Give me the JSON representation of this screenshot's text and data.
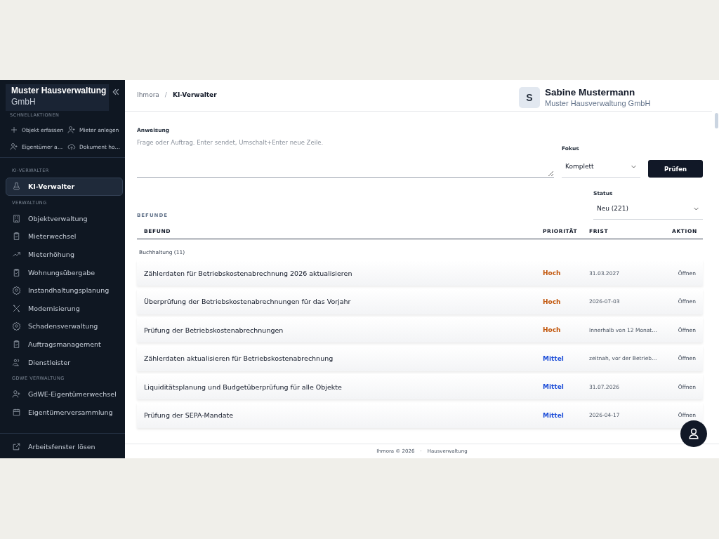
{
  "sidebar": {
    "org_name": "Muster Hausverwaltung",
    "org_suffix": "GmbH",
    "quick_actions_heading": "SCHNELLAKTIONEN",
    "quick_actions": [
      "Objekt erfassen",
      "Mieter anlegen",
      "Eigentümer a…",
      "Dokument ho…"
    ],
    "sections": [
      {
        "heading": "KI-VERWALTER",
        "items": [
          {
            "label": "KI-Verwalter",
            "selected": true
          }
        ]
      },
      {
        "heading": "VERWALTUNG",
        "items": [
          {
            "label": "Objektverwaltung",
            "selected": false
          },
          {
            "label": "Mieterwechsel",
            "selected": false
          },
          {
            "label": "Mieterhöhung",
            "selected": false
          },
          {
            "label": "Wohnungsübergabe",
            "selected": false
          },
          {
            "label": "Instandhaltungsplanung",
            "selected": false
          },
          {
            "label": "Modernisierung",
            "selected": false
          },
          {
            "label": "Schadensverwaltung",
            "selected": false
          },
          {
            "label": "Auftragsmanagement",
            "selected": false
          },
          {
            "label": "Dienstleister",
            "selected": false
          }
        ]
      },
      {
        "heading": "GDWE VERWALTUNG",
        "items": [
          {
            "label": "GdWE-Eigentümerwechsel",
            "selected": false
          },
          {
            "label": "Eigentümerversammlung",
            "selected": false
          }
        ]
      }
    ],
    "footer_link": "Arbeitsfenster lösen"
  },
  "breadcrumb": [
    "Ihmora",
    "/",
    "KI-Verwalter"
  ],
  "user": {
    "initial": "S",
    "name": "Sabine Mustermann",
    "company": "Muster Hausverwaltung GmbH"
  },
  "instruction": {
    "label": "Anweisung",
    "placeholder": "Frage oder Auftrag. Enter sendet, Umschalt+Enter neue Zeile."
  },
  "focus": {
    "label": "Fokus",
    "value": "Komplett"
  },
  "submit_button": "Prüfen",
  "status": {
    "label": "Status",
    "value": "Neu (221)"
  },
  "findings": {
    "heading": "BEFUNDE",
    "columns": [
      "BEFUND",
      "PRIORITÄT",
      "FRIST",
      "AKTION"
    ],
    "group": "Buchhaltung (11)",
    "rows": [
      {
        "title": "Zählerdaten für Betriebskostenabrechnung 2026 aktualisieren",
        "priority": "Hoch",
        "color": "#c2570c",
        "deadline": "31.03.2027",
        "action": "Öffnen"
      },
      {
        "title": "Überprüfung der Betriebskostenabrechnungen für das Vorjahr",
        "priority": "Hoch",
        "color": "#c2570c",
        "deadline": "2026-07-03",
        "action": "Öffnen"
      },
      {
        "title": "Prüfung der Betriebskostenabrechnungen",
        "priority": "Hoch",
        "color": "#c2570c",
        "deadline": "Innerhalb von 12 Monat…",
        "action": "Öffnen"
      },
      {
        "title": "Zählerdaten aktualisieren für Betriebskostenabrechnung",
        "priority": "Mittel",
        "color": "#1d4ed8",
        "deadline": "zeitnah, vor der Betrieb…",
        "action": "Öffnen"
      },
      {
        "title": "Liquiditätsplanung und Budgetüberprüfung für alle Objekte",
        "priority": "Mittel",
        "color": "#1d4ed8",
        "deadline": "31.07.2026",
        "action": "Öffnen"
      },
      {
        "title": "Prüfung der SEPA-Mandate",
        "priority": "Mittel",
        "color": "#1d4ed8",
        "deadline": "2026-04-17",
        "action": "Öffnen"
      }
    ]
  },
  "footer": [
    "Ihmora © 2026",
    "·",
    "Hausverwaltung"
  ]
}
